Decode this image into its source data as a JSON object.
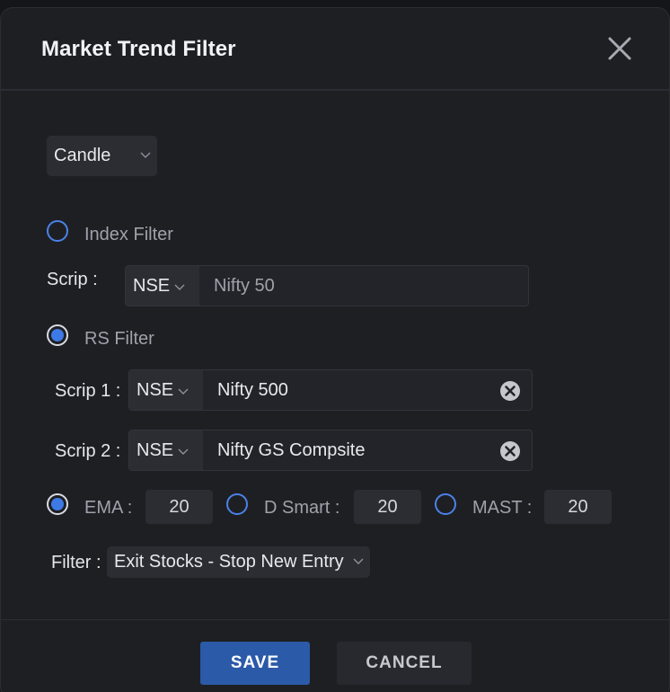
{
  "dialog": {
    "title": "Market Trend Filter"
  },
  "chart_type": {
    "selected": "Candle"
  },
  "index_filter": {
    "label": "Index Filter",
    "checked": false,
    "scrip_label": "Scrip :",
    "exchange": "NSE",
    "value": "Nifty 50"
  },
  "rs_filter": {
    "label": "RS Filter",
    "checked": true,
    "scrip1": {
      "label": "Scrip 1 :",
      "exchange": "NSE",
      "value": "Nifty 500"
    },
    "scrip2": {
      "label": "Scrip 2 :",
      "exchange": "NSE",
      "value": "Nifty GS Compsite"
    }
  },
  "indicators": {
    "ema": {
      "label": "EMA :",
      "value": "20",
      "checked": true
    },
    "dsmart": {
      "label": "D Smart :",
      "value": "20",
      "checked": false
    },
    "mast": {
      "label": "MAST :",
      "value": "20",
      "checked": false
    }
  },
  "filter": {
    "label": "Filter :",
    "selected": "Exit Stocks - Stop New Entry"
  },
  "footer": {
    "save_label": "SAVE",
    "cancel_label": "CANCEL"
  },
  "colors": {
    "accent": "#3d7ae6",
    "save_button": "#2b5aa8",
    "background": "#1e1f23"
  }
}
